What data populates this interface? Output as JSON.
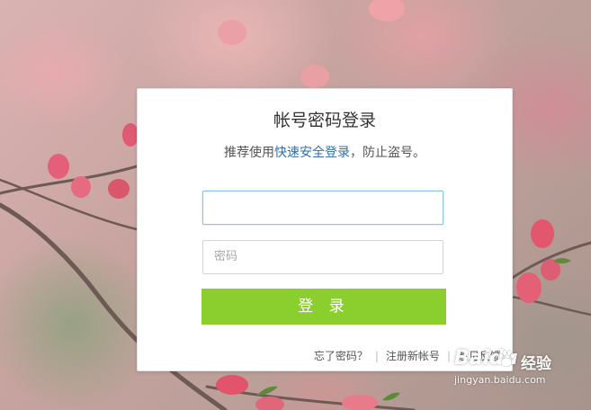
{
  "login": {
    "title": "帐号密码登录",
    "subtitle_prefix": "推荐使用",
    "subtitle_link": "快速安全登录",
    "subtitle_suffix": "，防止盗号。",
    "account_value": "",
    "password_placeholder": "密码",
    "submit_label": "登 录",
    "links": [
      "忘了密码？",
      "注册新帐号",
      "意见反馈"
    ]
  },
  "watermark": {
    "brand": "Baidu",
    "jingyan": "经验",
    "url": "jingyan.baidu.com"
  },
  "colors": {
    "accent_green": "#8bcf2e",
    "link_blue": "#2f6fb0",
    "focus_border": "#8ec3ea"
  }
}
